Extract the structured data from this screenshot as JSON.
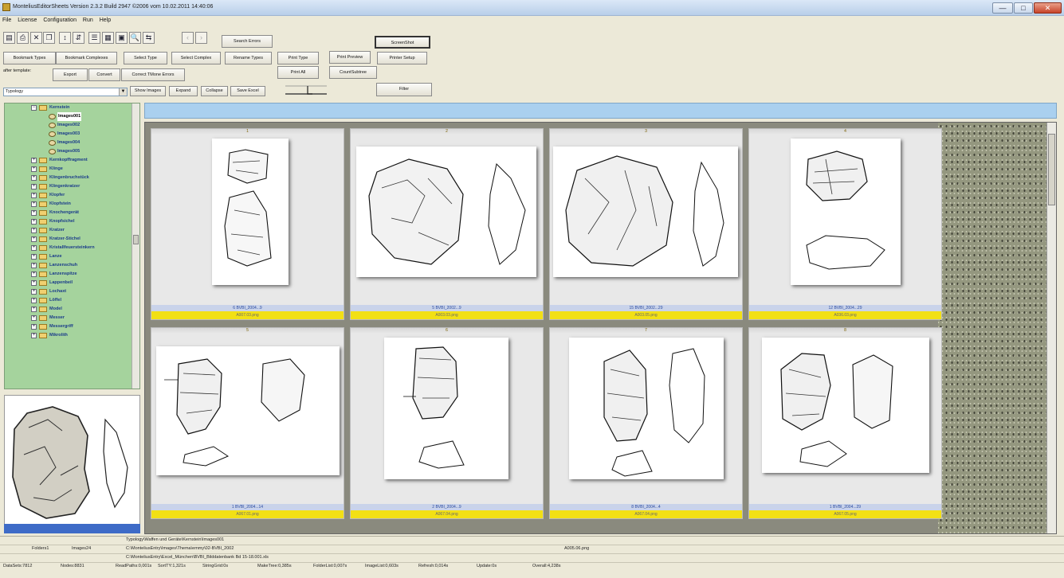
{
  "window": {
    "title": "MonteliusEditorSheets Version 2.3.2 Build 2947 ©2006 vom 10.02.2011 14:40:06",
    "minimize": "—",
    "maximize": "□",
    "close": "✕"
  },
  "menu": [
    "File",
    "License",
    "Configuration",
    "Run",
    "Help"
  ],
  "toolbar": {
    "search_errors": "Search Errors",
    "screenshot": "ScreenShot",
    "printer_setup": "Printer Setup",
    "bookmark_types": "Bookmark Types",
    "bookmark_complexes": "Bookmark Complexes",
    "select_type": "Select Type",
    "select_complex": "Select Complex",
    "rename_types": "Rename Types",
    "print_type": "Print Type",
    "print_preview": "Print Preview",
    "after_templates_label": "after template:",
    "export": "Export",
    "convert": "Convert",
    "correct_tmone_errors": "Correct TMone Errors",
    "print_all": "Print All",
    "countsubtree": "CountSubtree",
    "show_images": "Show Images",
    "expand": "Expand",
    "collapse": "Collapse",
    "save_excel": "Save Excel",
    "filter": "Filter",
    "typology_combo": "Typology"
  },
  "tree": {
    "items": [
      {
        "label": "Kernstein",
        "level": 1,
        "type": "folder",
        "expanded": true
      },
      {
        "label": "Images001",
        "level": 2,
        "type": "image",
        "selected": true
      },
      {
        "label": "Images002",
        "level": 2,
        "type": "image"
      },
      {
        "label": "Images003",
        "level": 2,
        "type": "image"
      },
      {
        "label": "Images004",
        "level": 2,
        "type": "image"
      },
      {
        "label": "Images005",
        "level": 2,
        "type": "image"
      },
      {
        "label": "Kernkopffragment",
        "level": 1,
        "type": "folder"
      },
      {
        "label": "Klinge",
        "level": 1,
        "type": "folder"
      },
      {
        "label": "Klingenbruchstück",
        "level": 1,
        "type": "folder"
      },
      {
        "label": "Klingenkratzer",
        "level": 1,
        "type": "folder"
      },
      {
        "label": "Klopfer",
        "level": 1,
        "type": "folder"
      },
      {
        "label": "Klopfstein",
        "level": 1,
        "type": "folder"
      },
      {
        "label": "Knochengerät",
        "level": 1,
        "type": "folder"
      },
      {
        "label": "Knopfsichel",
        "level": 1,
        "type": "folder"
      },
      {
        "label": "Kratzer",
        "level": 1,
        "type": "folder"
      },
      {
        "label": "Kratzer-Stichel",
        "level": 1,
        "type": "folder"
      },
      {
        "label": "Kristallfeuersteinkern",
        "level": 1,
        "type": "folder"
      },
      {
        "label": "Lanze",
        "level": 1,
        "type": "folder"
      },
      {
        "label": "Lanzenschuh",
        "level": 1,
        "type": "folder"
      },
      {
        "label": "Lanzenspitze",
        "level": 1,
        "type": "folder"
      },
      {
        "label": "Lappenbeil",
        "level": 1,
        "type": "folder"
      },
      {
        "label": "Lochaxt",
        "level": 1,
        "type": "folder"
      },
      {
        "label": "Löffel",
        "level": 1,
        "type": "folder"
      },
      {
        "label": "Model",
        "level": 1,
        "type": "folder"
      },
      {
        "label": "Messer",
        "level": 1,
        "type": "folder"
      },
      {
        "label": "Messergriff",
        "level": 1,
        "type": "folder"
      },
      {
        "label": "Mikrolith",
        "level": 1,
        "type": "folder"
      }
    ]
  },
  "grid": {
    "cards": [
      {
        "num": "1",
        "caption": "6 BVBI_2004...9",
        "file": "A007.03.png"
      },
      {
        "num": "2",
        "caption": "5 BVBI_2002...9",
        "file": "A003.03.png"
      },
      {
        "num": "3",
        "caption": "15 BVBI_2002...29",
        "file": "A003.05.png"
      },
      {
        "num": "4",
        "caption": "12 BVBI_2004...29",
        "file": "A036.03.png"
      },
      {
        "num": "5",
        "caption": "1 BVBI_2004...14",
        "file": "A067.01.png"
      },
      {
        "num": "6",
        "caption": "2 BVBI_2004...9",
        "file": "A067.04.png"
      },
      {
        "num": "7",
        "caption": "8 BVBI_2004...4",
        "file": "A067.04.png"
      },
      {
        "num": "8",
        "caption": "1 BVBI_2004...29",
        "file": "A067.05.png"
      }
    ]
  },
  "status": {
    "typology_path": "Typology\\Waffen und Geräte\\Kernstein\\Images001",
    "folders": "Folders1",
    "images": "Images24",
    "images_path": "C:\\MonteliusEntry\\Images\\Thema\\emmy\\02-BVBI_2002",
    "file": "A005.06.png",
    "excel_path": "C:\\MonteliusEntry\\Excel_München\\BVBI_Bilddatenbank Bd 15-18.001.xls",
    "stats": [
      "DataSets:7812",
      "Nodes:8831",
      "ReadPaths:0,001s",
      "SortTY:1,321s",
      "StringGrid:0s",
      "MakeTree:0,385s",
      "FolderList:0,007s",
      "ImageList:0,603s",
      "Refresh:0,014s",
      "Update:0s",
      "Overall:4,238s"
    ]
  },
  "colors": {
    "tree_bg": "#a5d39d",
    "path_bar": "#aad0ef",
    "caption_yellow": "#f2e015",
    "preview_bar": "#3e6bc7"
  }
}
